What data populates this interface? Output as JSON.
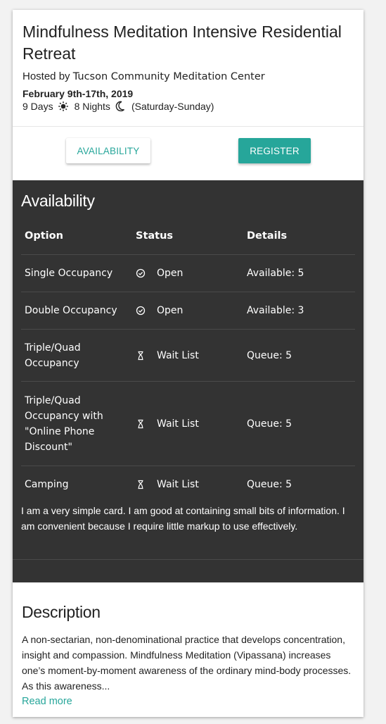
{
  "event": {
    "title": "Mindfulness Meditation Intensive Residential Retreat",
    "hosted_prefix": "Hosted by",
    "host": "Tucson Community Meditation Center",
    "dates": "February 9th-17th, 2019",
    "days": "9 Days",
    "nights": "8 Nights",
    "range": "(Saturday-Sunday)"
  },
  "actions": {
    "availability_label": "Availability",
    "register_label": "Register"
  },
  "availability": {
    "title": "Availability",
    "columns": [
      "Option",
      "Status",
      "Details"
    ],
    "rows": [
      {
        "option": "Single Occupancy",
        "status": "Open",
        "status_icon": "check-circle-icon",
        "details": "Available: 5"
      },
      {
        "option": "Double Occupancy",
        "status": "Open",
        "status_icon": "check-circle-icon",
        "details": "Available: 3"
      },
      {
        "option": "Triple/Quad Occupancy",
        "status": "Wait List",
        "status_icon": "hourglass-icon",
        "details": "Queue: 5"
      },
      {
        "option": "Triple/Quad Occupancy with \"Online Phone Discount\"",
        "status": "Wait List",
        "status_icon": "hourglass-icon",
        "details": "Queue: 5"
      },
      {
        "option": "Camping",
        "status": "Wait List",
        "status_icon": "hourglass-icon",
        "details": "Queue: 5"
      }
    ],
    "card_text": "I am a very simple card. I am good at containing small bits of information. I am convenient because I require little markup to use effectively."
  },
  "description": {
    "title": "Description",
    "text": "A non-sectarian, non-denominational practice that develops concentration, insight and compassion. Mindfulness Meditation (Vipassana) increases one’s moment-by-moment awareness of the ordinary mind-body processes. As this awareness...",
    "read_more": "Read more"
  },
  "colors": {
    "accent": "#26a69a",
    "dark_panel": "#333333"
  }
}
